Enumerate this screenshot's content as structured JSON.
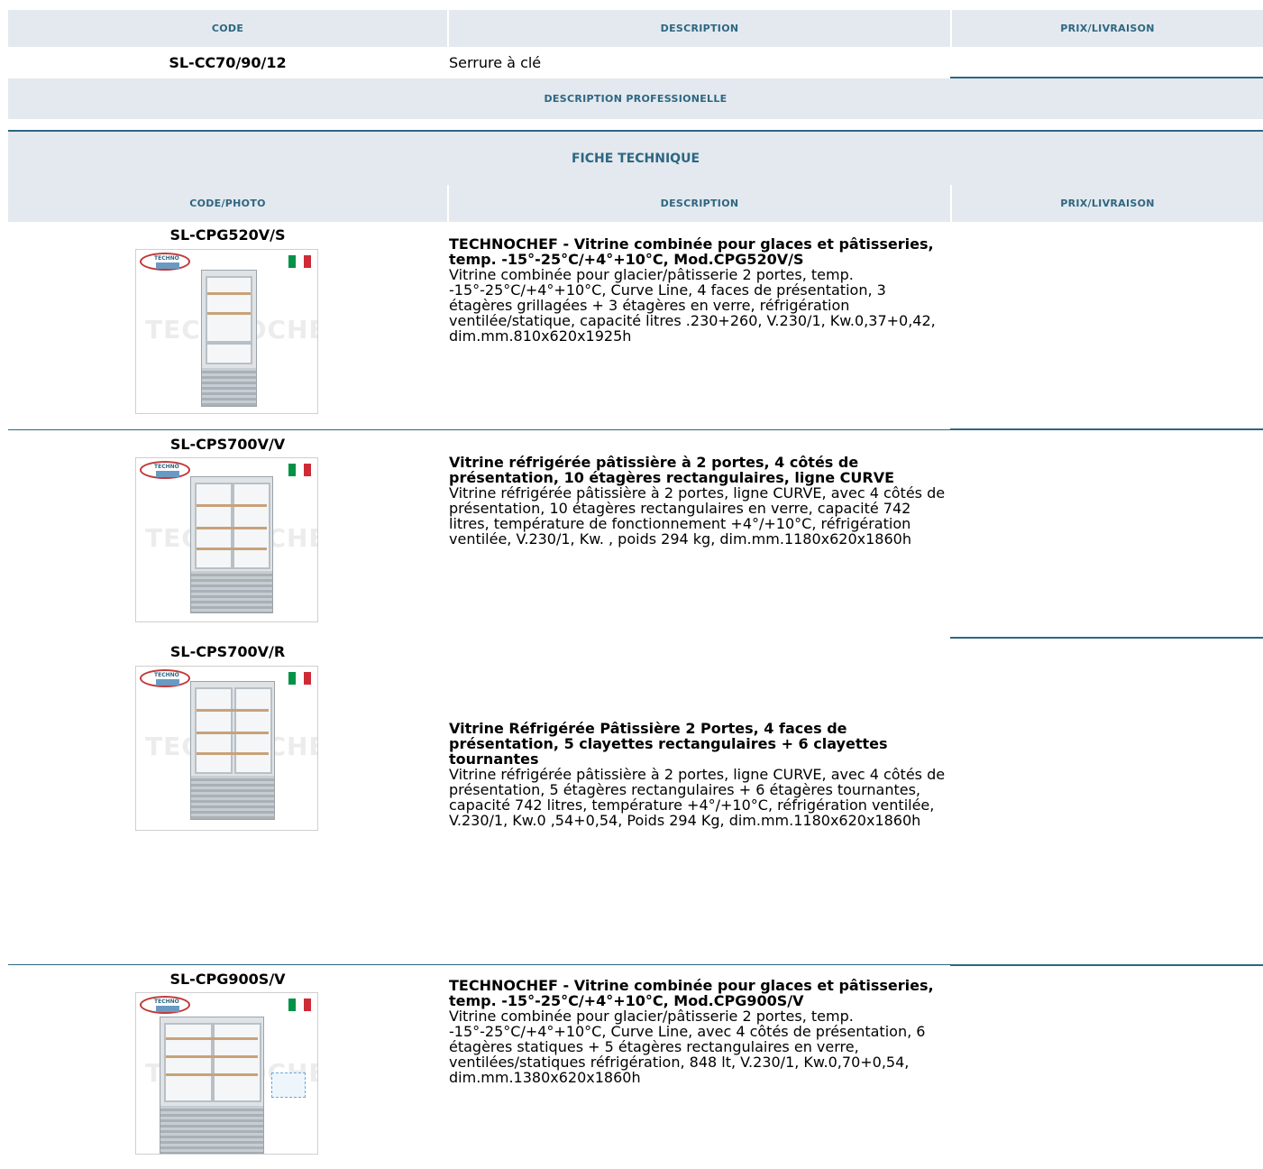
{
  "header": {
    "code": "CODE",
    "description": "DESCRIPTION",
    "price": "PRIX/LIVRAISON"
  },
  "simple_row": {
    "code": "SL-CC70/90/12",
    "description": "Serrure à clé"
  },
  "band_pro": "DESCRIPTION PROFESSIONELLE",
  "band_fiche": "FICHE TECHNIQUE",
  "header2": {
    "code": "CODE/PHOTO",
    "description": "DESCRIPTION",
    "price": "PRIX/LIVRAISON"
  },
  "brand": {
    "line1": "TECHNO",
    "line2": "CHEF",
    "watermark": "TECHNOCHEF.IT"
  },
  "flag_colors": [
    "#009246",
    "#ffffff",
    "#ce2b37"
  ],
  "accent_color": "#2e6682",
  "products": [
    {
      "code": "SL-CPG520V/S",
      "title": "TECHNOCHEF - Vitrine combinée pour glaces et pâtisseries, temp. -15°-25°C/+4°+10°C, Mod.CPG520V/S",
      "body": "Vitrine combinée pour glacier/pâtisserie 2 portes, temp. -15°-25°C/+4°+10°C, Curve Line, 4 faces de présentation, 3 étagères grillagées + 3 étagères en verre, réfrigération ventilée/statique, capacité litres .230+260, V.230/1, Kw.0,37+0,42, dim.mm.810x620x1925h"
    },
    {
      "code": "SL-CPS700V/V",
      "title": "Vitrine réfrigérée pâtissière à 2 portes, 4 côtés de présentation, 10 étagères rectangulaires, ligne CURVE",
      "body": "Vitrine réfrigérée pâtissière à 2 portes, ligne CURVE, avec 4 côtés de présentation, 10 étagères rectangulaires en verre, capacité 742 litres, température de fonctionnement +4°/+10°C, réfrigération ventilée, V.230/1, Kw. , poids 294 kg, dim.mm.1180x620x1860h"
    },
    {
      "code": "SL-CPS700V/R",
      "title": "Vitrine Réfrigérée Pâtissière 2 Portes, 4 faces de présentation, 5 clayettes rectangulaires + 6 clayettes tournantes",
      "body": "Vitrine réfrigérée pâtissière à 2 portes, ligne CURVE, avec 4 côtés de présentation, 5 étagères rectangulaires + 6 étagères tournantes, capacité 742 litres, température +4°/+10°C, réfrigération ventilée, V.230/1, Kw.0 ,54+0,54, Poids 294 Kg, dim.mm.1180x620x1860h"
    },
    {
      "code": "SL-CPG900S/V",
      "title": "TECHNOCHEF - Vitrine combinée pour glaces et pâtisseries, temp. -15°-25°C/+4°+10°C, Mod.CPG900S/V",
      "body": "Vitrine combinée pour glacier/pâtisserie 2 portes, temp. -15°-25°C/+4°+10°C, Curve Line, avec 4 côtés de présentation, 6 étagères statiques + 5 étagères rectangulaires en verre, ventilées/statiques réfrigération, 848 lt, V.230/1, Kw.0,70+0,54, dim.mm.1380x620x1860h"
    }
  ]
}
